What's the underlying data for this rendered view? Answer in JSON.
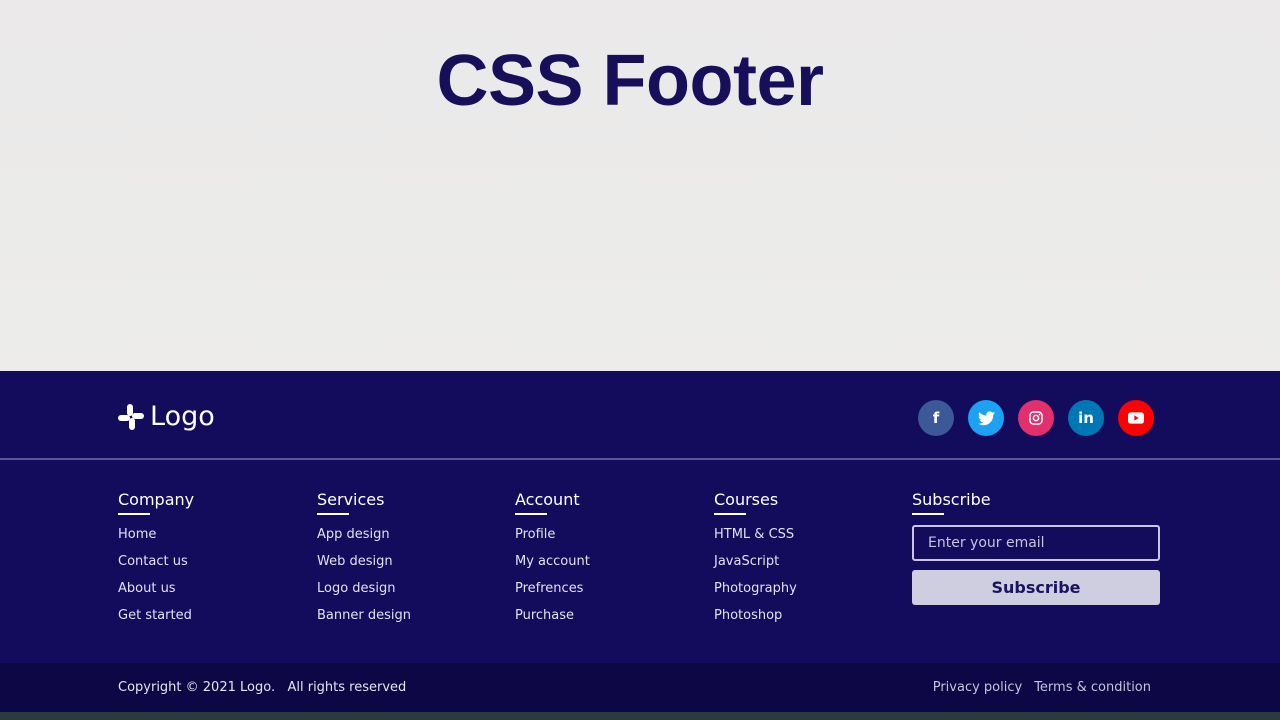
{
  "hero": {
    "title": "CSS Footer"
  },
  "footer": {
    "logo_text": "Logo",
    "socials": [
      {
        "icon": "facebook-icon",
        "glyph": "f",
        "color": "#3b5998"
      },
      {
        "icon": "twitter-icon",
        "glyph": "🐦",
        "color": "#1da1f2"
      },
      {
        "icon": "instagram-icon",
        "glyph": "◎",
        "color": "#e1306c"
      },
      {
        "icon": "linkedin-icon",
        "glyph": "in",
        "color": "#0077b5"
      },
      {
        "icon": "youtube-icon",
        "glyph": "▶",
        "color": "#ff0000"
      }
    ],
    "columns": [
      {
        "title": "Company",
        "links": [
          "Home",
          "Contact us",
          "About us",
          "Get started"
        ]
      },
      {
        "title": "Services",
        "links": [
          "App design",
          "Web design",
          "Logo design",
          "Banner design"
        ]
      },
      {
        "title": "Account",
        "links": [
          "Profile",
          "My account",
          "Prefrences",
          "Purchase"
        ]
      },
      {
        "title": "Courses",
        "links": [
          "HTML & CSS",
          "JavaScript",
          "Photography",
          "Photoshop"
        ]
      }
    ],
    "subscribe": {
      "title": "Subscribe",
      "email_placeholder": "Enter your email",
      "email_value": "",
      "button_label": "Subscribe"
    },
    "bottom": {
      "copyright": "Copyright © 2021 Logo.   All rights reserved",
      "links": [
        "Privacy policy",
        "Terms & condition"
      ]
    },
    "colors": {
      "footer_bg": "#130b5c",
      "bottom_bg": "#0d0745",
      "title": "#170f5a"
    }
  }
}
